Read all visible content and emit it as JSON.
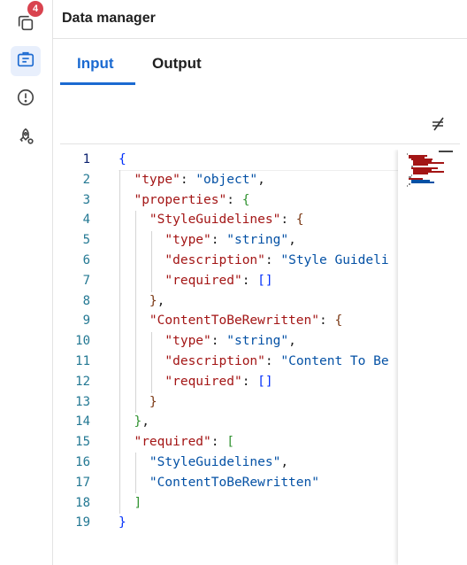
{
  "sidebar": {
    "badge_count": "4",
    "items": [
      {
        "name": "files-icon"
      },
      {
        "name": "briefcase-icon"
      },
      {
        "name": "alert-icon"
      },
      {
        "name": "rocket-icon"
      }
    ]
  },
  "header": {
    "title": "Data manager"
  },
  "tabs": [
    {
      "label": "Input",
      "active": true
    },
    {
      "label": "Output",
      "active": false
    }
  ],
  "toolbar": {
    "wrap_toggle_icon": "word-wrap-toggle-icon"
  },
  "editor": {
    "line_numbers": [
      "1",
      "2",
      "3",
      "4",
      "5",
      "6",
      "7",
      "8",
      "9",
      "10",
      "11",
      "12",
      "13",
      "14",
      "15",
      "16",
      "17",
      "18",
      "19"
    ],
    "lines": [
      "{",
      "  \"type\": \"object\",",
      "  \"properties\": {",
      "    \"StyleGuidelines\": {",
      "      \"type\": \"string\",",
      "      \"description\": \"Style Guideli",
      "      \"required\": []",
      "    },",
      "    \"ContentToBeRewritten\": {",
      "      \"type\": \"string\",",
      "      \"description\": \"Content To Be",
      "      \"required\": []",
      "    }",
      "  },",
      "  \"required\": [",
      "    \"StyleGuidelines\",",
      "    \"ContentToBeRewritten\"",
      "  ]",
      "}"
    ]
  },
  "colors": {
    "accent": "#1b6ad1",
    "badge": "#d9434f",
    "json_key": "#a31515",
    "json_string": "#0451a5",
    "bracket_level1": "#0431fa",
    "bracket_level2": "#319331",
    "bracket_level3": "#7b3814",
    "line_number": "#237893"
  }
}
